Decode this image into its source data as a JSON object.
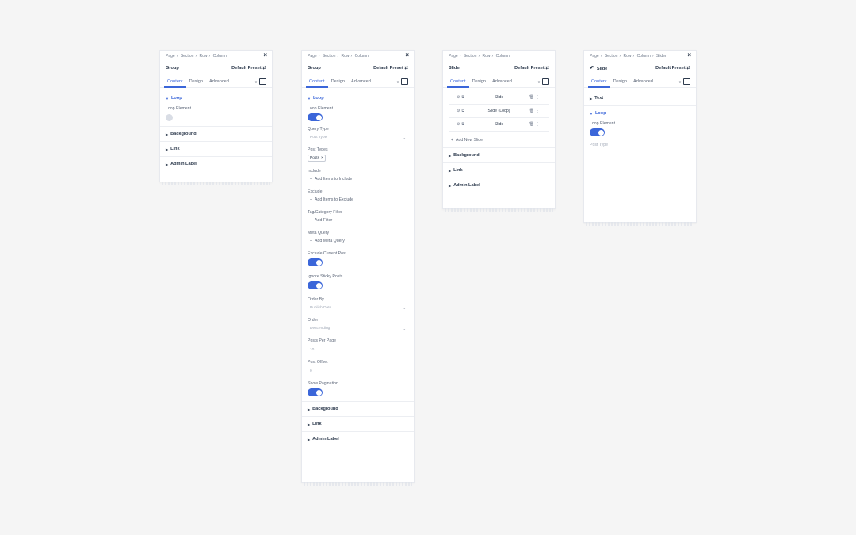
{
  "panels": [
    {
      "crumbs": [
        "Page",
        "Section",
        "Row",
        "Column"
      ],
      "title": "Group",
      "preset": "Default Preset",
      "tabs": [
        "Content",
        "Design",
        "Advanced"
      ],
      "loop": "Loop",
      "loop_element": "Loop Element",
      "sections": [
        "Background",
        "Link",
        "Admin Label"
      ]
    },
    {
      "crumbs": [
        "Page",
        "Section",
        "Row",
        "Column"
      ],
      "title": "Group",
      "preset": "Default Preset",
      "tabs": [
        "Content",
        "Design",
        "Advanced"
      ],
      "loop": "Loop",
      "loop_element": "Loop Element",
      "query_type": "Query Type",
      "query_type_placeholder": "Post Type",
      "post_types": "Post Types",
      "post_chip": "Posts",
      "include": "Include",
      "add_include": "Add Items to Include",
      "exclude": "Exclude",
      "add_exclude": "Add Items to Exclude",
      "tag_filter": "Tag/Category Filter",
      "add_filter": "Add Filter",
      "meta_query": "Meta Query",
      "add_meta": "Add Meta Query",
      "exclude_current": "Exclude Current Post",
      "ignore_sticky": "Ignore Sticky Posts",
      "order_by": "Order By",
      "order_by_value": "Publish Date",
      "order": "Order",
      "order_value": "Descending",
      "posts_per_page": "Posts Per Page",
      "posts_per_page_value": "10",
      "post_offset": "Post Offset",
      "post_offset_value": "0",
      "show_pagination": "Show Pagination",
      "sections": [
        "Background",
        "Link",
        "Admin Label"
      ]
    },
    {
      "crumbs": [
        "Page",
        "Section",
        "Row",
        "Column"
      ],
      "title": "Slider",
      "preset": "Default Preset",
      "tabs": [
        "Content",
        "Design",
        "Advanced"
      ],
      "slides": [
        "Slide",
        "Slide (Loop)",
        "Slide"
      ],
      "add_slide": "Add New Slide",
      "sections": [
        "Background",
        "Link",
        "Admin Label"
      ]
    },
    {
      "crumbs": [
        "Page",
        "Section",
        "Row",
        "Column",
        "Slider"
      ],
      "title": "Slide",
      "preset": "Default Preset",
      "tabs": [
        "Content",
        "Design",
        "Advanced"
      ],
      "text": "Text",
      "loop": "Loop",
      "loop_element": "Loop Element",
      "post_type": "Post Type"
    }
  ],
  "colors": {
    "accent": "#3b66d9",
    "text": "#2d3a4d",
    "muted": "#5b6577"
  }
}
